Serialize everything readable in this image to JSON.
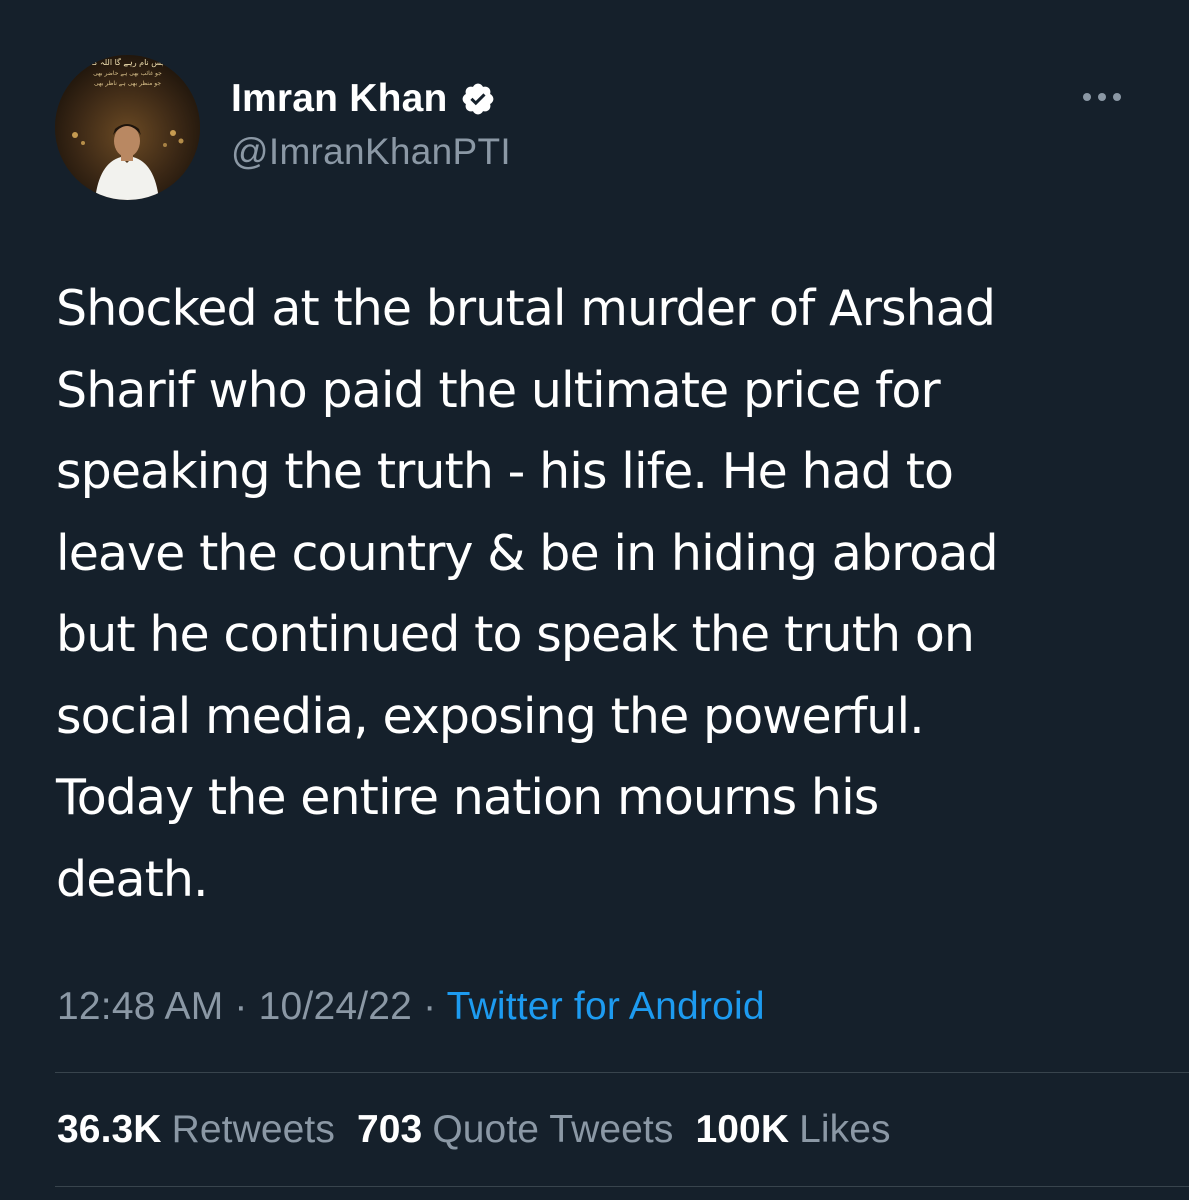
{
  "author": {
    "display_name": "Imran Khan",
    "handle": "@ImranKhanPTI",
    "verified": true,
    "avatar_icon": "profile-photo",
    "avatar_caption_lines": [
      "بس نام رہے گا اللہ کا",
      "جو غائب بھی ہے حاضر بھی",
      "جو منظر بھی ہے ناظر بھی"
    ]
  },
  "more_icon": "ellipsis-icon",
  "tweet": {
    "text": "Shocked at the brutal murder of Arshad\nSharif who paid the ultimate price for\nspeaking the truth - his life. He had to\nleave the country & be in hiding abroad\nbut he continued to speak the truth on\nsocial media, exposing the powerful.\nToday the entire nation mourns his\ndeath."
  },
  "meta": {
    "time": "12:48 AM",
    "separator": " · ",
    "date": "10/24/22",
    "source": "Twitter for Android"
  },
  "stats": [
    {
      "value": "36.3K",
      "label": "Retweets"
    },
    {
      "value": "703",
      "label": "Quote Tweets"
    },
    {
      "value": "100K",
      "label": "Likes"
    }
  ],
  "colors": {
    "background": "#15202b",
    "text_primary": "#ffffff",
    "text_secondary": "#8b98a5",
    "link": "#1d9bf0",
    "divider": "#38444d"
  }
}
